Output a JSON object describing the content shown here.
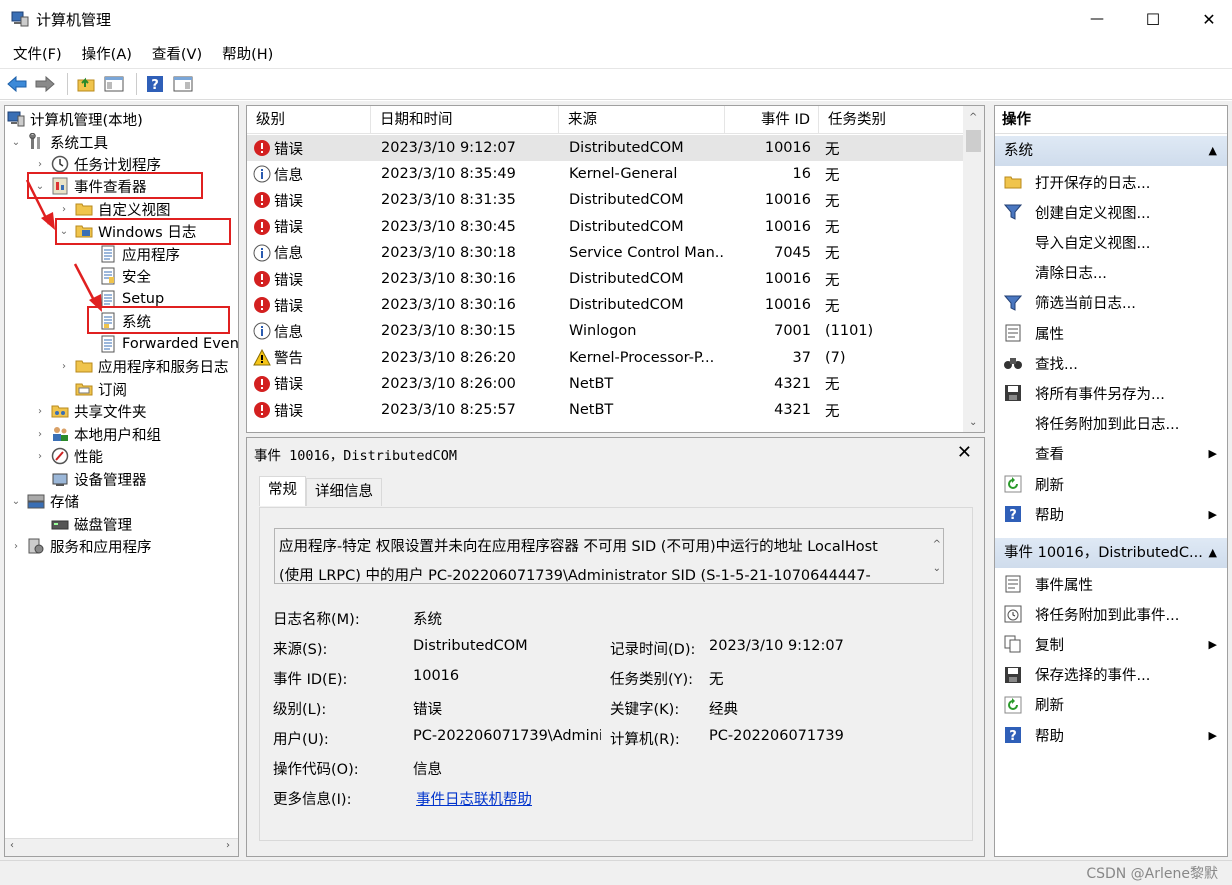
{
  "window": {
    "title": "计算机管理",
    "minimize": "—",
    "maximize": "☐",
    "close": "✕"
  },
  "menu": [
    "文件(F)",
    "操作(A)",
    "查看(V)",
    "帮助(H)"
  ],
  "toolbar": [
    "back-icon",
    "forward-icon",
    "up-folder-icon",
    "show-hide-tree-icon",
    "help-icon",
    "action-pane-icon"
  ],
  "tree": [
    {
      "label": "计算机管理(本地)",
      "exp": "",
      "icon": "computer-icon"
    },
    {
      "label": "系统工具",
      "exp": "⌄",
      "icon": "tools-icon"
    },
    {
      "label": "任务计划程序",
      "exp": "›",
      "icon": "clock-icon"
    },
    {
      "label": "事件查看器",
      "exp": "⌄",
      "icon": "event-viewer-icon"
    },
    {
      "label": "自定义视图",
      "exp": "›",
      "icon": "folder-icon"
    },
    {
      "label": "Windows 日志",
      "exp": "⌄",
      "icon": "folder-icon"
    },
    {
      "label": "应用程序",
      "exp": "",
      "icon": "log-icon"
    },
    {
      "label": "安全",
      "exp": "",
      "icon": "log-icon"
    },
    {
      "label": "Setup",
      "exp": "",
      "icon": "log-icon"
    },
    {
      "label": "系统",
      "exp": "",
      "icon": "log-icon"
    },
    {
      "label": "Forwarded Even",
      "exp": "",
      "icon": "log-icon"
    },
    {
      "label": "应用程序和服务日志",
      "exp": "›",
      "icon": "folder-icon"
    },
    {
      "label": "订阅",
      "exp": "",
      "icon": "subscription-icon"
    },
    {
      "label": "共享文件夹",
      "exp": "›",
      "icon": "shared-folder-icon"
    },
    {
      "label": "本地用户和组",
      "exp": "›",
      "icon": "users-icon"
    },
    {
      "label": "性能",
      "exp": "›",
      "icon": "performance-icon"
    },
    {
      "label": "设备管理器",
      "exp": "",
      "icon": "device-manager-icon"
    },
    {
      "label": "存储",
      "exp": "⌄",
      "icon": "storage-icon"
    },
    {
      "label": "磁盘管理",
      "exp": "",
      "icon": "disk-icon"
    },
    {
      "label": "服务和应用程序",
      "exp": "›",
      "icon": "services-icon"
    }
  ],
  "events": {
    "columns": [
      "级别",
      "日期和时间",
      "来源",
      "事件 ID",
      "任务类别"
    ],
    "rows": [
      {
        "level": "错误",
        "icon": "error",
        "time": "2023/3/10 9:12:07",
        "source": "DistributedCOM",
        "id": "10016",
        "task": "无"
      },
      {
        "level": "信息",
        "icon": "info",
        "time": "2023/3/10 8:35:49",
        "source": "Kernel-General",
        "id": "16",
        "task": "无"
      },
      {
        "level": "错误",
        "icon": "error",
        "time": "2023/3/10 8:31:35",
        "source": "DistributedCOM",
        "id": "10016",
        "task": "无"
      },
      {
        "level": "错误",
        "icon": "error",
        "time": "2023/3/10 8:30:45",
        "source": "DistributedCOM",
        "id": "10016",
        "task": "无"
      },
      {
        "level": "信息",
        "icon": "info",
        "time": "2023/3/10 8:30:18",
        "source": "Service Control Man...",
        "id": "7045",
        "task": "无"
      },
      {
        "level": "错误",
        "icon": "error",
        "time": "2023/3/10 8:30:16",
        "source": "DistributedCOM",
        "id": "10016",
        "task": "无"
      },
      {
        "level": "错误",
        "icon": "error",
        "time": "2023/3/10 8:30:16",
        "source": "DistributedCOM",
        "id": "10016",
        "task": "无"
      },
      {
        "level": "信息",
        "icon": "info",
        "time": "2023/3/10 8:30:15",
        "source": "Winlogon",
        "id": "7001",
        "task": "(1101)"
      },
      {
        "level": "警告",
        "icon": "warning",
        "time": "2023/3/10 8:26:20",
        "source": "Kernel-Processor-P...",
        "id": "37",
        "task": "(7)"
      },
      {
        "level": "错误",
        "icon": "error",
        "time": "2023/3/10 8:26:00",
        "source": "NetBT",
        "id": "4321",
        "task": "无"
      },
      {
        "level": "错误",
        "icon": "error",
        "time": "2023/3/10 8:25:57",
        "source": "NetBT",
        "id": "4321",
        "task": "无"
      }
    ]
  },
  "detail": {
    "title": "事件 10016，DistributedCOM",
    "close": "✕",
    "tabs": [
      "常规",
      "详细信息"
    ],
    "description_line1": "应用程序-特定 权限设置并未向在应用程序容器 不可用 SID (不可用)中运行的地址 LocalHost",
    "description_line2": "(使用 LRPC) 中的用户 PC-202206071739\\Administrator SID (S-1-5-21-1070644447-",
    "fields": {
      "logname_label": "日志名称(M):",
      "logname": "系统",
      "source_label": "来源(S):",
      "source": "DistributedCOM",
      "recorded_label": "记录时间(D):",
      "recorded": "2023/3/10 9:12:07",
      "eventid_label": "事件 ID(E):",
      "eventid": "10016",
      "task_label": "任务类别(Y):",
      "task": "无",
      "level_label": "级别(L):",
      "level": "错误",
      "keywords_label": "关键字(K):",
      "keywords": "经典",
      "user_label": "用户(U):",
      "user": "PC-202206071739\\Admini",
      "computer_label": "计算机(R):",
      "computer": "PC-202206071739",
      "opcode_label": "操作代码(O):",
      "opcode": "信息",
      "moreinfo_label": "更多信息(I):",
      "moreinfo": "事件日志联机帮助"
    }
  },
  "actions": {
    "title": "操作",
    "section1": "系统",
    "items1": [
      {
        "label": "打开保存的日志...",
        "icon": "open-folder-icon",
        "arrow": ""
      },
      {
        "label": "创建自定义视图...",
        "icon": "filter-icon",
        "arrow": ""
      },
      {
        "label": "导入自定义视图...",
        "icon": "",
        "arrow": ""
      },
      {
        "label": "清除日志...",
        "icon": "",
        "arrow": ""
      },
      {
        "label": "筛选当前日志...",
        "icon": "filter-icon",
        "arrow": ""
      },
      {
        "label": "属性",
        "icon": "properties-icon",
        "arrow": ""
      },
      {
        "label": "查找...",
        "icon": "binoculars-icon",
        "arrow": ""
      },
      {
        "label": "将所有事件另存为...",
        "icon": "save-icon",
        "arrow": ""
      },
      {
        "label": "将任务附加到此日志...",
        "icon": "",
        "arrow": ""
      },
      {
        "label": "查看",
        "icon": "",
        "arrow": "▶"
      },
      {
        "label": "刷新",
        "icon": "refresh-icon",
        "arrow": ""
      },
      {
        "label": "帮助",
        "icon": "help-icon",
        "arrow": "▶"
      }
    ],
    "section2": "事件 10016，DistributedC...",
    "items2": [
      {
        "label": "事件属性",
        "icon": "properties-icon",
        "arrow": ""
      },
      {
        "label": "将任务附加到此事件...",
        "icon": "task-icon",
        "arrow": ""
      },
      {
        "label": "复制",
        "icon": "copy-icon",
        "arrow": "▶"
      },
      {
        "label": "保存选择的事件...",
        "icon": "save-icon",
        "arrow": ""
      },
      {
        "label": "刷新",
        "icon": "refresh-icon",
        "arrow": ""
      },
      {
        "label": "帮助",
        "icon": "help-icon",
        "arrow": "▶"
      }
    ]
  },
  "watermark": "CSDN @Arlene黎默"
}
